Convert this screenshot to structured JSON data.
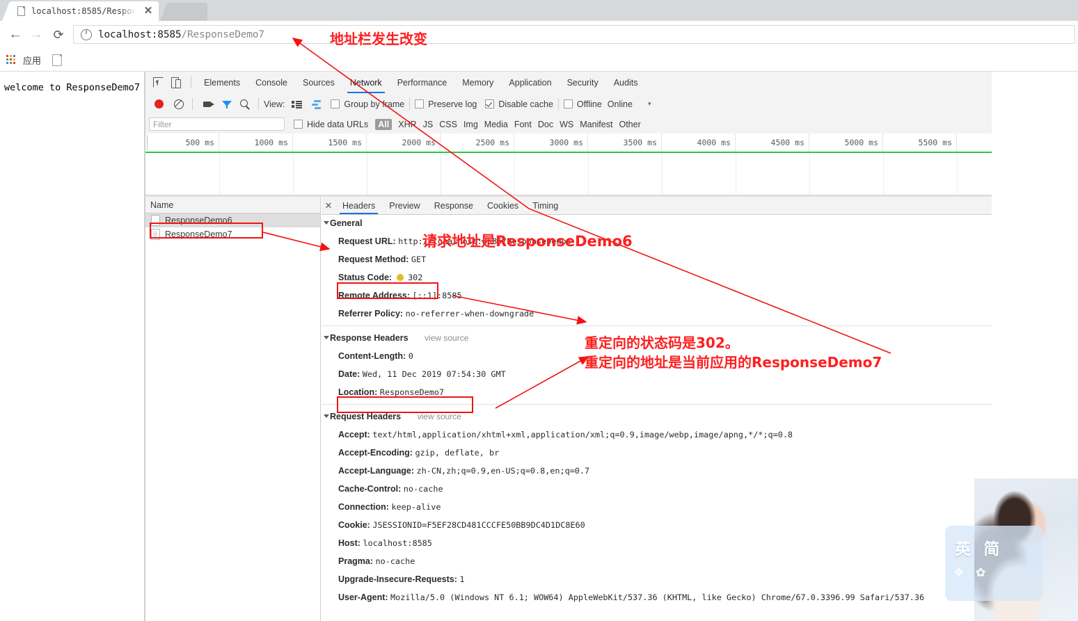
{
  "browser": {
    "tab": {
      "title": "localhost:8585/Respons",
      "close_label": "✕",
      "favicon": "page-icon"
    },
    "nav": {
      "back": "←",
      "forward": "→",
      "reload": "⟳"
    },
    "omnibox": {
      "info_icon": "info-icon",
      "host": "localhost:8585",
      "path": "/ResponseDemo7",
      "full_url": "localhost:8585/ResponseDemo7"
    },
    "bookmarks": {
      "apps_label": "应用",
      "apps_icon": "apps-grid-icon",
      "doc_icon": "page-icon"
    }
  },
  "page": {
    "body_text": "welcome to ResponseDemo7"
  },
  "devtools": {
    "icons": {
      "inspect": "inspect-element-icon",
      "device": "device-toolbar-icon"
    },
    "panels": [
      "Elements",
      "Console",
      "Sources",
      "Network",
      "Performance",
      "Memory",
      "Application",
      "Security",
      "Audits"
    ],
    "active_panel": "Network",
    "toolbar": {
      "record_icon": "record-icon",
      "clear_icon": "clear-icon",
      "screenshots_icon": "capture-screenshots-icon",
      "filter_icon": "filter-icon",
      "search_icon": "search-icon",
      "view_label": "View:",
      "large_rows_icon": "view-large-rows-icon",
      "overview_icon": "view-overview-icon",
      "group_by_frame": "Group by frame",
      "preserve_log": "Preserve log",
      "disable_cache": "Disable cache",
      "offline": "Offline",
      "online": "Online",
      "throttle_caret": "▾"
    },
    "filterbar": {
      "filter_placeholder": "Filter",
      "hide_data_urls": "Hide data URLs",
      "types": [
        "All",
        "XHR",
        "JS",
        "CSS",
        "Img",
        "Media",
        "Font",
        "Doc",
        "WS",
        "Manifest",
        "Other"
      ],
      "selected_type": "All"
    },
    "overview": {
      "ticks": [
        "500 ms",
        "1000 ms",
        "1500 ms",
        "2000 ms",
        "2500 ms",
        "3000 ms",
        "3500 ms",
        "4000 ms",
        "4500 ms",
        "5000 ms",
        "5500 ms"
      ],
      "domcontentloaded_color": "#28c840"
    },
    "requests": {
      "column_header": "Name",
      "rows": [
        {
          "name": "ResponseDemo6",
          "selected": true
        },
        {
          "name": "ResponseDemo7",
          "selected": false
        }
      ]
    },
    "detail": {
      "close_icon": "close-icon",
      "tabs": [
        "Headers",
        "Preview",
        "Response",
        "Cookies",
        "Timing"
      ],
      "active_tab": "Headers",
      "general": {
        "title": "General",
        "rows": [
          {
            "key": "Request URL:",
            "value": "http://localhost:8585/ResponseDemo6"
          },
          {
            "key": "Request Method:",
            "value": "GET"
          },
          {
            "key": "Status Code:",
            "value": "302",
            "badge": "#f0b429"
          },
          {
            "key": "Remote Address:",
            "value": "[::1]:8585"
          },
          {
            "key": "Referrer Policy:",
            "value": "no-referrer-when-downgrade"
          }
        ]
      },
      "response_headers": {
        "title": "Response Headers",
        "view_source": "view source",
        "rows": [
          {
            "key": "Content-Length:",
            "value": "0"
          },
          {
            "key": "Date:",
            "value": "Wed, 11 Dec 2019 07:54:30 GMT"
          },
          {
            "key": "Location:",
            "value": "ResponseDemo7"
          }
        ]
      },
      "request_headers": {
        "title": "Request Headers",
        "view_source": "view source",
        "rows": [
          {
            "key": "Accept:",
            "value": "text/html,application/xhtml+xml,application/xml;q=0.9,image/webp,image/apng,*/*;q=0.8"
          },
          {
            "key": "Accept-Encoding:",
            "value": "gzip, deflate, br"
          },
          {
            "key": "Accept-Language:",
            "value": "zh-CN,zh;q=0.9,en-US;q=0.8,en;q=0.7"
          },
          {
            "key": "Cache-Control:",
            "value": "no-cache"
          },
          {
            "key": "Connection:",
            "value": "keep-alive"
          },
          {
            "key": "Cookie:",
            "value": "JSESSIONID=F5EF28CD481CCCFE50BB9DC4D1DC8E60"
          },
          {
            "key": "Host:",
            "value": "localhost:8585"
          },
          {
            "key": "Pragma:",
            "value": "no-cache"
          },
          {
            "key": "Upgrade-Insecure-Requests:",
            "value": "1"
          },
          {
            "key": "User-Agent:",
            "value": "Mozilla/5.0 (Windows NT 6.1; WOW64) AppleWebKit/537.36 (KHTML, like Gecko) Chrome/67.0.3396.99 Safari/537.36"
          }
        ]
      }
    }
  },
  "annotations": {
    "color": "#ff1f1f",
    "address_bar_changed": "地址栏发生改变",
    "request_url_is": "请求地址是ResponseDemo6",
    "redirect_status_code": "重定向的状态码是302。",
    "redirect_location": "重定向的地址是当前应用的ResponseDemo7"
  },
  "watermark": {
    "title": "英 简",
    "subtitle": "❖ ✿"
  }
}
